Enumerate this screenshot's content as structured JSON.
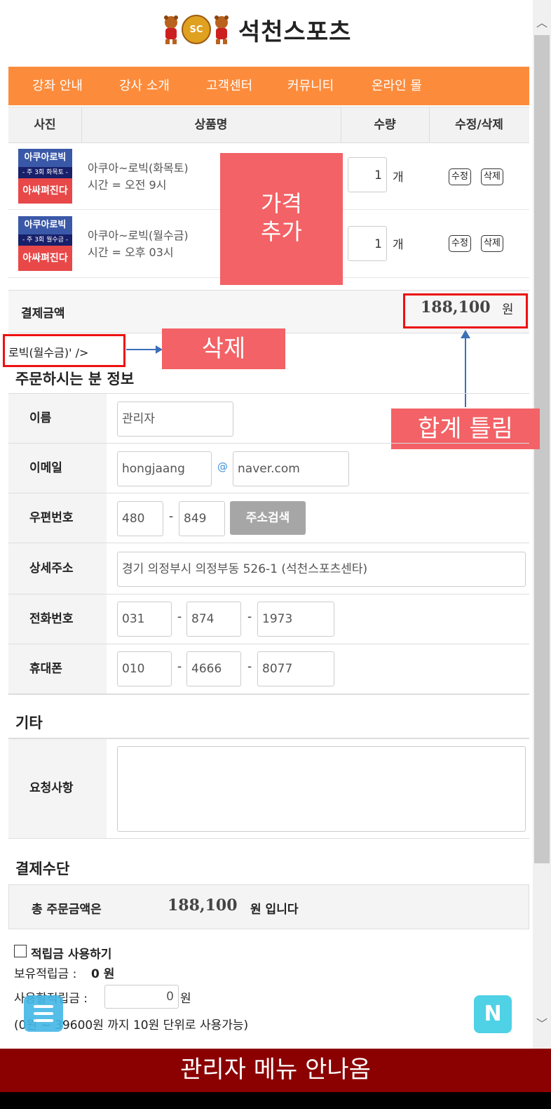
{
  "brand": {
    "logo_badge": "SC",
    "title": "석천스포츠"
  },
  "nav": {
    "items": [
      "강좌 안내",
      "강사 소개",
      "고객센터",
      "커뮤니티",
      "온라인 몰"
    ]
  },
  "cart": {
    "headers": {
      "photo": "사진",
      "name": "상품명",
      "qty": "수량",
      "edit": "수정/삭제"
    },
    "items": [
      {
        "thumb_top": "아쿠아로빅",
        "thumb_mid": "- 주 3회 화목토 -",
        "thumb_bottom": "아싸펴진다",
        "name": "아쿠아~로빅(화목토)",
        "time": "시간 = 오전 9시",
        "qty": "1",
        "unit": "개",
        "edit": "수정",
        "delete": "삭제"
      },
      {
        "thumb_top": "아쿠아로빅",
        "thumb_mid": "- 주 3회 월수금 -",
        "thumb_bottom": "아싸펴진다",
        "name": "아쿠아~로빅(월수금)",
        "time": "시간 = 오후 03시",
        "qty": "1",
        "unit": "개",
        "edit": "수정",
        "delete": "삭제"
      }
    ],
    "pay_label": "결제금액",
    "pay_amount": "188,100",
    "pay_unit": "원"
  },
  "annotations": {
    "price_add": "가격\n추가",
    "delete_label": "삭제",
    "leaked_text": "로빅(월수금)' />",
    "total_wrong": "합계 틀림",
    "admin_menu": "관리자 메뉴 안나옴"
  },
  "orderer": {
    "title": "주문하시는 분 정보",
    "name_label": "이름",
    "name_value": "관리자",
    "email_label": "이메일",
    "email_id": "hongjaang",
    "email_at": "@",
    "email_domain": "naver.com",
    "zip_label": "우편번호",
    "zip1": "480",
    "zip2": "849",
    "zip_dash": "-",
    "zip_button": "주소검색",
    "addr_label": "상세주소",
    "addr_value": "경기 의정부시 의정부동 526-1 (석천스포츠센타)",
    "phone_label": "전화번호",
    "phone1": "031",
    "phone2": "874",
    "phone3": "1973",
    "mobile_label": "휴대폰",
    "mobile1": "010",
    "mobile2": "4666",
    "mobile3": "8077"
  },
  "etc": {
    "title": "기타",
    "request_label": "요청사항",
    "request_value": ""
  },
  "payment": {
    "title": "결제수단",
    "total_label": "총 주문금액은",
    "total_amount": "188,100",
    "total_suffix": "원 입니다",
    "points_checkbox": "적립금 사용하기",
    "points_have_label": "보유적립금 :",
    "points_have_value": "0 원",
    "points_use_label": "사용할적립금 :",
    "points_use_value": "0",
    "points_use_unit": "원",
    "points_note": "(0원 ~ 39600원 까지 10원 단위로 사용가능)"
  },
  "colors": {
    "nav": "#fc8c3c",
    "annotation": "#f26266",
    "highlight": "#ee1010",
    "admin_bar": "#8b0000"
  },
  "icons": {
    "menu": "hamburger-icon",
    "naver": "naver-n-icon",
    "scroll_up": "chevron-up-icon",
    "scroll_down": "chevron-down-icon"
  }
}
